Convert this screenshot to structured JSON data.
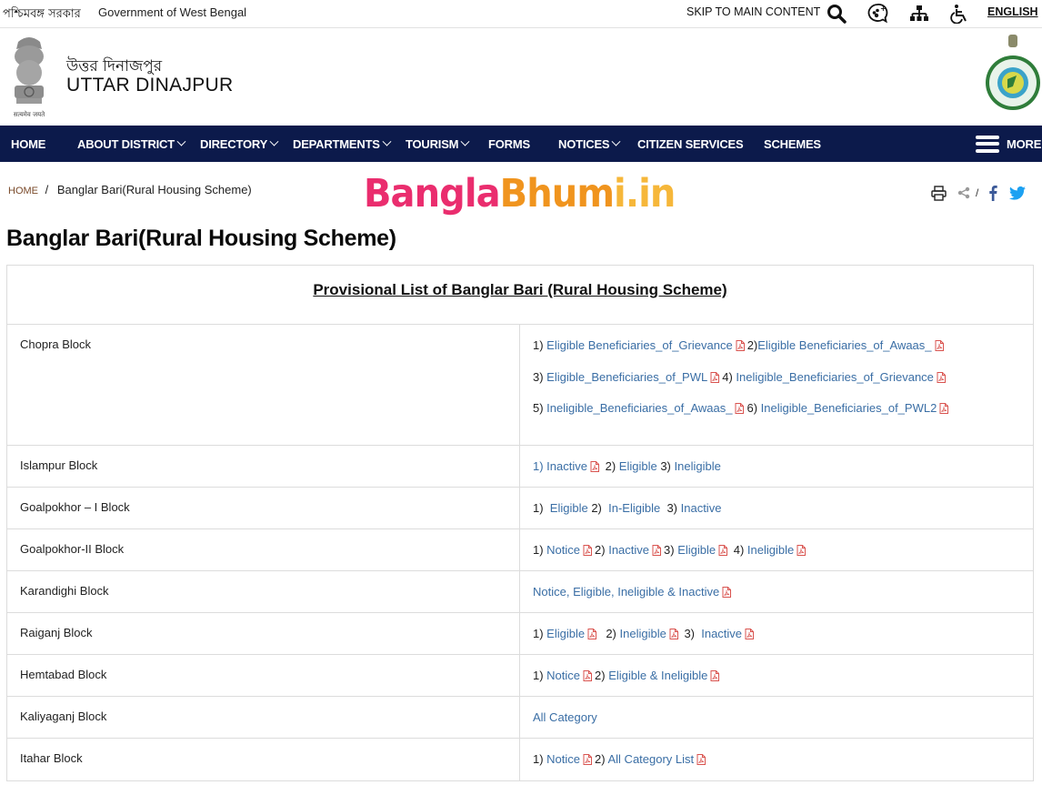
{
  "topbar": {
    "state_name_bn": "পশ্চিমবঙ্গ সরকার",
    "state_name_en": "Government of West Bengal",
    "skip_link": "SKIP TO MAIN CONTENT",
    "icons": [
      "search-icon",
      "social-media-icon",
      "sitemap-icon",
      "accessibility-icon"
    ],
    "language": "ENGLISH"
  },
  "header": {
    "district_bn": "উত্তর দিনাজপুর",
    "district_en": "UTTAR DINAJPUR",
    "emblem_left": "national-emblem-logo",
    "emblem_right": "west-bengal-emblem-logo"
  },
  "nav": {
    "items": [
      {
        "label": "HOME",
        "dropdown": false
      },
      {
        "label": "ABOUT DISTRICT",
        "dropdown": true
      },
      {
        "label": "DIRECTORY",
        "dropdown": true
      },
      {
        "label": "DEPARTMENTS",
        "dropdown": true
      },
      {
        "label": "TOURISM",
        "dropdown": true
      },
      {
        "label": "FORMS",
        "dropdown": false
      },
      {
        "label": "NOTICES",
        "dropdown": true
      },
      {
        "label": "CITIZEN SERVICES",
        "dropdown": false
      },
      {
        "label": "SCHEMES",
        "dropdown": false
      }
    ],
    "more_label": "MORE",
    "background": "#0c1a4b"
  },
  "breadcrumb": {
    "home": "HOME",
    "separator": "/",
    "current": "Banglar Bari(Rural Housing Scheme)"
  },
  "watermark": {
    "part1": "Bangla",
    "part2": "Bhum",
    "part3": "i.in"
  },
  "share": {
    "print": "print-icon",
    "share": "share-icon",
    "separator": "/",
    "facebook": "facebook-icon",
    "twitter": "twitter-icon"
  },
  "page_title": "Banglar Bari(Rural Housing Scheme)",
  "table": {
    "caption": "Provisional List of Banglar Bari (Rural Housing Scheme)",
    "rows": [
      {
        "block": "Chopra Block",
        "lines": [
          [
            {
              "prefix": "1) ",
              "link": "Eligible Beneficiaries_of_Grievance",
              "pdf": true
            },
            {
              "prefix": "2)",
              "link": "Eligible Beneficiaries_of_Awaas_",
              "pdf": true
            }
          ],
          [
            {
              "prefix": "3) ",
              "link": "Eligible_Beneficiaries_of_PWL",
              "pdf": true
            },
            {
              "prefix": "4) ",
              "link": "Ineligible_Beneficiaries_of_Grievance",
              "pdf": true
            }
          ],
          [
            {
              "prefix": "5) ",
              "link": "Ineligible_Beneficiaries_of_Awaas_",
              "pdf": true
            },
            {
              "prefix": "6) ",
              "link": "Ineligible_Beneficiaries_of_PWL2",
              "pdf": true
            }
          ]
        ]
      },
      {
        "block": "Islampur Block",
        "lines": [
          [
            {
              "prefix": "",
              "link": "1) Inactive",
              "pdf": true
            },
            {
              "prefix": " 2) ",
              "link": "Eligible",
              "pdf": false
            },
            {
              "prefix": " 3) ",
              "link": "Ineligible",
              "pdf": false
            }
          ]
        ]
      },
      {
        "block": "Goalpokhor – I Block",
        "lines": [
          [
            {
              "prefix": "1)  ",
              "link": "Eligible",
              "pdf": false
            },
            {
              "prefix": " 2)  ",
              "link": "In-Eligible",
              "pdf": false
            },
            {
              "prefix": "  3) ",
              "link": "Inactive",
              "pdf": false
            }
          ]
        ]
      },
      {
        "block": "Goalpokhor-II Block",
        "lines": [
          [
            {
              "prefix": "1) ",
              "link": "Notice",
              "pdf": true
            },
            {
              "prefix": "2) ",
              "link": "Inactive",
              "pdf": true
            },
            {
              "prefix": "3) ",
              "link": "Eligible",
              "pdf": true
            },
            {
              "prefix": " 4) ",
              "link": "Ineligible",
              "pdf": true
            }
          ]
        ]
      },
      {
        "block": "Karandighi Block",
        "lines": [
          [
            {
              "prefix": "",
              "link": "Notice, Eligible, Ineligible & Inactive",
              "pdf": true
            }
          ]
        ]
      },
      {
        "block": "Raiganj Block",
        "lines": [
          [
            {
              "prefix": "1) ",
              "link": "Eligible",
              "pdf": true
            },
            {
              "prefix": "  2) ",
              "link": "Ineligible",
              "pdf": true
            },
            {
              "prefix": " 3)  ",
              "link": "Inactive",
              "pdf": true
            }
          ]
        ]
      },
      {
        "block": "Hemtabad Block",
        "lines": [
          [
            {
              "prefix": "1) ",
              "link": "Notice",
              "pdf": true
            },
            {
              "prefix": "2) ",
              "link": "Eligible & Ineligible",
              "pdf": true
            }
          ]
        ]
      },
      {
        "block": "Kaliyaganj Block",
        "lines": [
          [
            {
              "prefix": "",
              "link": "All Category",
              "pdf": false
            }
          ]
        ]
      },
      {
        "block": "Itahar Block",
        "lines": [
          [
            {
              "prefix": "1) ",
              "link": "Notice",
              "pdf": true
            },
            {
              "prefix": "2) ",
              "link": "All Category List",
              "pdf": true
            }
          ]
        ]
      }
    ]
  },
  "colors": {
    "link": "#3a6ea5",
    "pdf_icon": "#d9534f",
    "nav_bg": "#0c1a4b"
  }
}
